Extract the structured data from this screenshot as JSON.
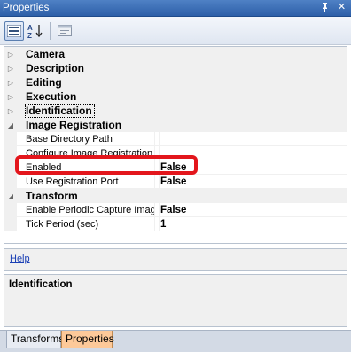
{
  "window": {
    "title": "Properties",
    "pin_glyph": "↑",
    "close_glyph": "✕"
  },
  "toolbar": {
    "categorized_icon": "categorized-icon",
    "alphabetical_icon": "alphabetical-icon",
    "property_pages_icon": "property-pages-icon"
  },
  "grid": {
    "categories": [
      {
        "label": "Camera",
        "expanded": false
      },
      {
        "label": "Description",
        "expanded": false
      },
      {
        "label": "Editing",
        "expanded": false
      },
      {
        "label": "Execution",
        "expanded": false
      },
      {
        "label": "Identification",
        "expanded": false
      },
      {
        "label": "Image Registration",
        "expanded": true
      },
      {
        "label": "Transform",
        "expanded": true
      }
    ],
    "image_registration": [
      {
        "name": "Base Directory Path",
        "value": ""
      },
      {
        "name": "Configure Image Registration",
        "value": ""
      },
      {
        "name": "Enabled",
        "value": "False"
      },
      {
        "name": "Use Registration Port",
        "value": "False"
      }
    ],
    "transform": [
      {
        "name": "Enable Periodic Capture Imag",
        "value": "False"
      },
      {
        "name": "Tick Period (sec)",
        "value": "1"
      }
    ]
  },
  "help": {
    "link": "Help"
  },
  "description": {
    "heading": "Identification"
  },
  "tabs": [
    {
      "label": "Transforms",
      "active": false
    },
    {
      "label": "Properties",
      "active": true
    }
  ],
  "colors": {
    "title_bar": "#2d5fa8",
    "highlight": "#e3161c",
    "active_tab": "#fdc999"
  }
}
